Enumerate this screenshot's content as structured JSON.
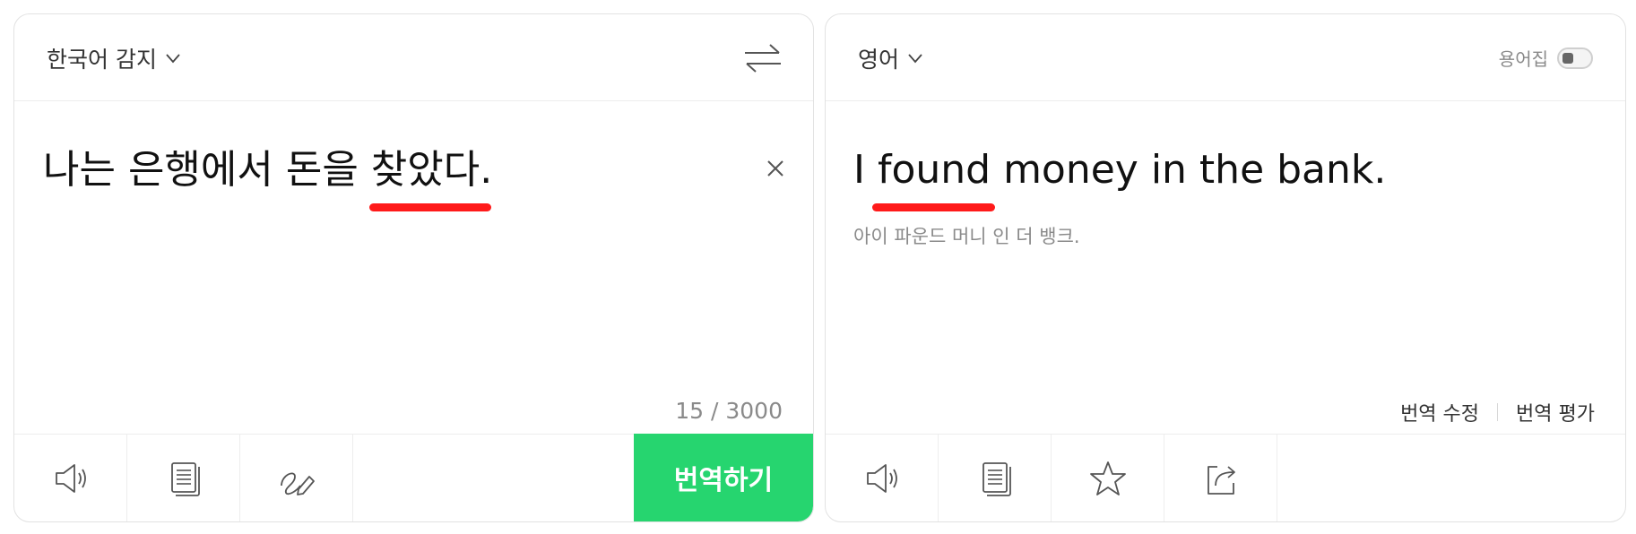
{
  "source_panel": {
    "language_label": "한국어 감지",
    "text": "나는 은행에서 돈을 찾았다.",
    "char_count": "15 / 3000",
    "translate_button": "번역하기"
  },
  "target_panel": {
    "language_label": "영어",
    "glossary_label": "용어집",
    "text": "I found money in the bank.",
    "pronunciation": "아이 파운드 머니 인 더 뱅크.",
    "edit_translation": "번역 수정",
    "rate_translation": "번역 평가"
  },
  "colors": {
    "accent": "#26d56f",
    "highlight": "#ff1a1a"
  },
  "icons": {
    "source_toolbar": [
      "speaker-icon",
      "copy-icon",
      "handwriting-icon"
    ],
    "target_toolbar": [
      "speaker-icon",
      "copy-icon",
      "star-icon",
      "share-icon"
    ]
  }
}
